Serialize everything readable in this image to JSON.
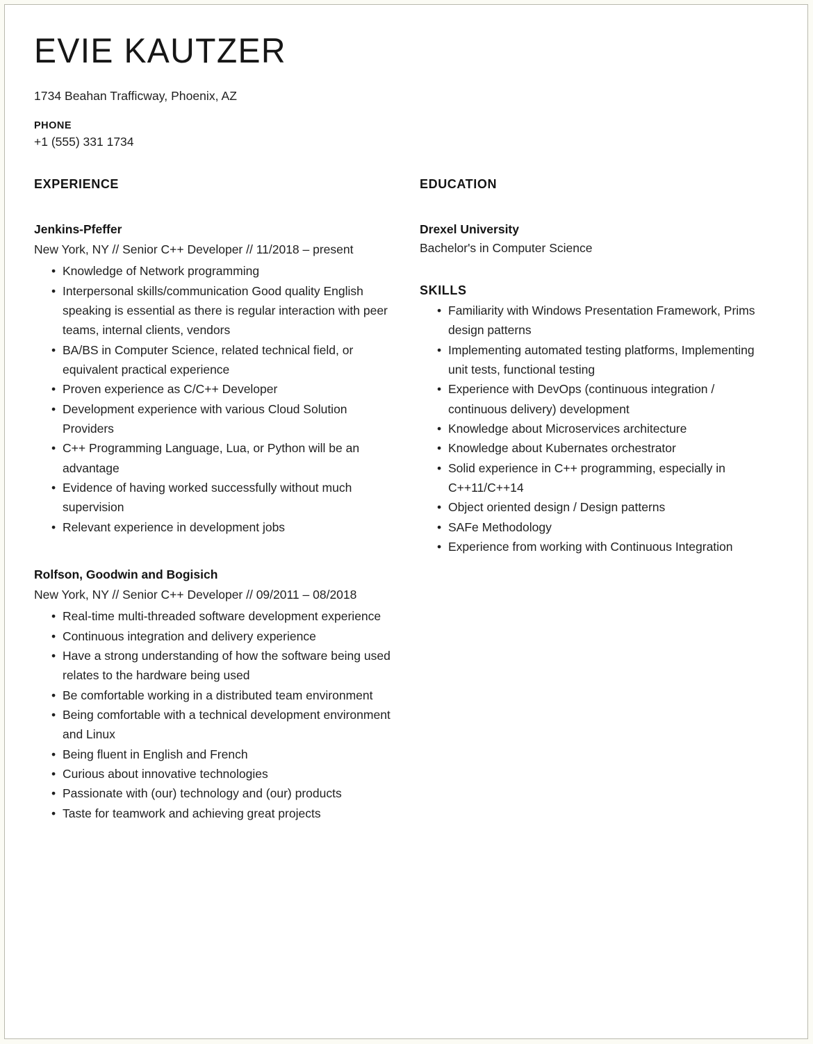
{
  "document": {
    "type": "resume",
    "page_background": "#ffffff",
    "canvas_background": "#fbfbf4",
    "border_color": "#b9b9ad",
    "text_color": "#1f1f1f",
    "heading_color": "#141414"
  },
  "header": {
    "name": "EVIE KAUTZER",
    "address": "1734 Beahan Trafficway, Phoenix, AZ",
    "phone_label": "PHONE",
    "phone_value": "+1 (555) 331 1734"
  },
  "experience": {
    "heading": "EXPERIENCE",
    "entries": [
      {
        "company": "Jenkins-Pfeffer",
        "meta": "New York, NY // Senior C++ Developer // 11/2018 – present",
        "bullets": [
          "Knowledge of Network programming",
          "Interpersonal skills/communication Good quality English speaking is essential as there is regular interaction with peer teams, internal clients, vendors",
          "BA/BS in Computer Science, related technical field, or equivalent practical experience",
          "Proven experience as C/C++ Developer",
          "Development experience with various Cloud Solution Providers",
          "C++ Programming Language, Lua, or Python will be an advantage",
          "Evidence of having worked successfully without much supervision",
          "Relevant experience in development jobs"
        ]
      },
      {
        "company": "Rolfson, Goodwin and Bogisich",
        "meta": "New York, NY // Senior C++ Developer // 09/2011 – 08/2018",
        "bullets": [
          "Real-time multi-threaded software development experience",
          "Continuous integration and delivery experience",
          "Have a strong understanding of how the software being used relates to the hardware being used",
          "Be comfortable working in a distributed team environment",
          "Being comfortable with a technical development environment and Linux",
          "Being fluent in English and French",
          "Curious about innovative technologies",
          "Passionate with (our) technology and (our) products",
          "Taste for teamwork and achieving great projects"
        ]
      }
    ]
  },
  "education": {
    "heading": "EDUCATION",
    "entries": [
      {
        "school": "Drexel University",
        "degree": "Bachelor's in Computer Science"
      }
    ]
  },
  "skills": {
    "heading": "SKILLS",
    "items": [
      "Familiarity with Windows Presentation Framework, Prims design patterns",
      "Implementing automated testing platforms, Implementing unit tests, functional testing",
      "Experience with DevOps (continuous integration / continuous delivery) development",
      "Knowledge about Microservices architecture",
      "Knowledge about Kubernates orchestrator",
      "Solid experience in C++ programming, especially in C++11/C++14",
      "Object oriented design / Design patterns",
      "SAFe Methodology",
      "Experience from working with Continuous Integration"
    ]
  }
}
